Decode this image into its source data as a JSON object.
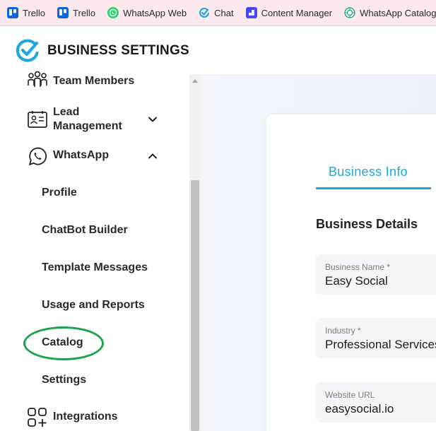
{
  "bookmarks": [
    {
      "label": "Trello",
      "icon": "trello-icon"
    },
    {
      "label": "Trello",
      "icon": "trello-icon"
    },
    {
      "label": "WhatsApp Web",
      "icon": "whatsapp-icon"
    },
    {
      "label": "Chat",
      "icon": "chat-check-icon"
    },
    {
      "label": "Content Manager",
      "icon": "content-manager-icon"
    },
    {
      "label": "WhatsApp Catalogu...",
      "icon": "openai-icon"
    }
  ],
  "header": {
    "title": "BUSINESS SETTINGS"
  },
  "sidebar": {
    "team_members": "Team Members",
    "lead_line1": "Lead",
    "lead_line2": "Management",
    "whatsapp": "WhatsApp",
    "sub_items": [
      "Profile",
      "ChatBot Builder",
      "Template Messages",
      "Usage and Reports",
      "Catalog",
      "Settings"
    ],
    "integrations": "Integrations"
  },
  "main": {
    "tab": "Business Info",
    "section_title": "Business Details",
    "fields": [
      {
        "label": "Business Name *",
        "value": "Easy Social"
      },
      {
        "label": "Industry *",
        "value": "Professional Services"
      },
      {
        "label": "Website URL",
        "value": "easysocial.io"
      }
    ]
  },
  "colors": {
    "accent": "#1ea7e1",
    "highlight": "#1aa34a",
    "bookmark_bar": "#fbe9ee"
  }
}
